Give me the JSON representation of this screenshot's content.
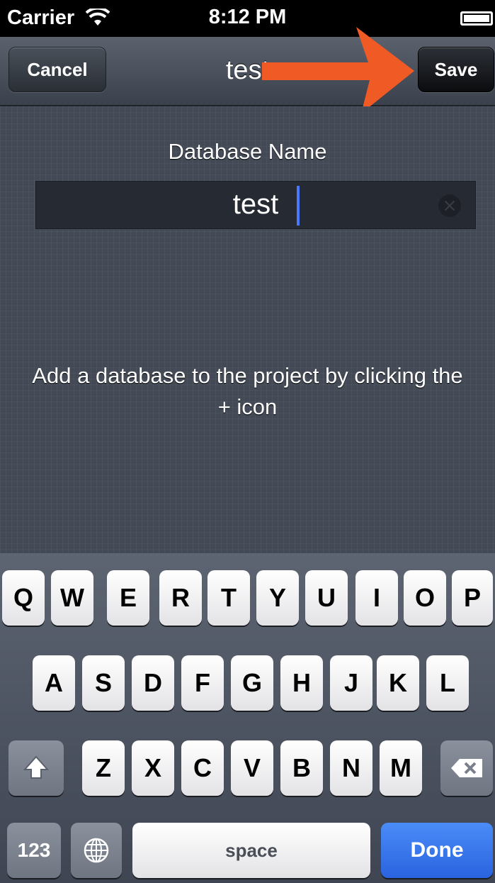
{
  "status_bar": {
    "carrier": "Carrier",
    "time": "8:12 PM"
  },
  "nav": {
    "cancel_label": "Cancel",
    "title": "test",
    "save_label": "Save"
  },
  "form": {
    "field_label": "Database Name",
    "field_value": "test",
    "hint": "Add a database to the project by clicking the + icon"
  },
  "keyboard": {
    "row1": [
      "Q",
      "W",
      "E",
      "R",
      "T",
      "Y",
      "U",
      "I",
      "O",
      "P"
    ],
    "row2": [
      "A",
      "S",
      "D",
      "F",
      "G",
      "H",
      "J",
      "K",
      "L"
    ],
    "row3": [
      "Z",
      "X",
      "C",
      "V",
      "B",
      "N",
      "M"
    ],
    "numbers_label": "123",
    "space_label": "space",
    "done_label": "Done"
  },
  "colors": {
    "arrow": "#f05a24",
    "done": "#2a63df",
    "cursor": "#4a78ff"
  },
  "annotation": {
    "icon": "arrow-right-icon",
    "target": "save-button"
  }
}
